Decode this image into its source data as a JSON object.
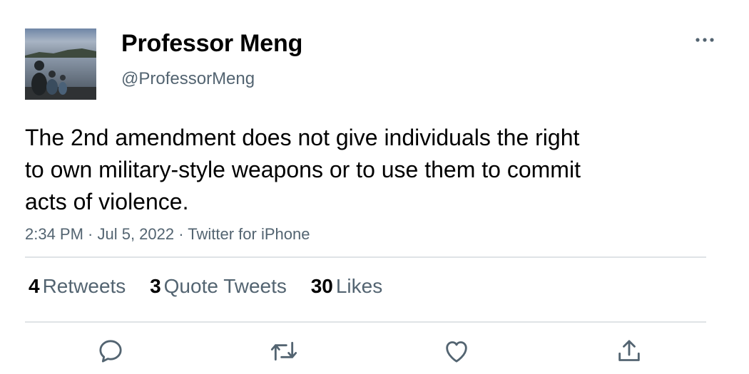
{
  "author": {
    "display_name": "Professor Meng",
    "handle": "@ProfessorMeng",
    "avatar_icon": "avatar"
  },
  "tweet": {
    "text_lines": [
      "The 2nd amendment does not give individuals the right",
      "to own military-style weapons or to use them to commit",
      "acts of violence."
    ],
    "meta": "2:34 PM · Jul 5, 2022 · Twitter for iPhone"
  },
  "stats": {
    "retweets": {
      "count": "4",
      "label": "Retweets"
    },
    "quotes": {
      "count": "3",
      "label": "Quote Tweets"
    },
    "likes": {
      "count": "30",
      "label": "Likes"
    }
  },
  "actions": {
    "reply_icon": "reply-icon",
    "retweet_icon": "retweet-icon",
    "like_icon": "heart-icon",
    "share_icon": "share-icon",
    "more_icon": "more-icon"
  },
  "colors": {
    "text_primary": "#000000",
    "text_secondary": "#536471",
    "divider": "#dfe3e6",
    "icon": "#536471"
  }
}
